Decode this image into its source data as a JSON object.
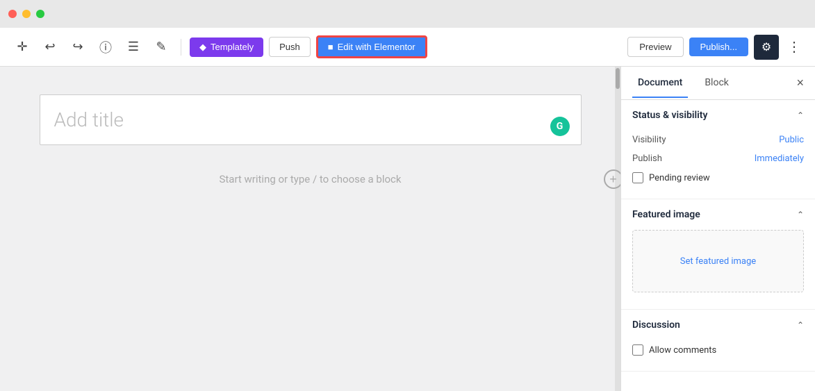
{
  "titlebar": {
    "traffic_lights": [
      "red",
      "yellow",
      "green"
    ]
  },
  "toolbar": {
    "add_label": "+",
    "undo_label": "↩",
    "redo_label": "↪",
    "info_label": "ℹ",
    "list_label": "☰",
    "edit_label": "✎",
    "templately_label": "Templately",
    "push_label": "Push",
    "elementor_label": "Edit with Elementor",
    "preview_label": "Preview",
    "publish_label": "Publish...",
    "settings_label": "⚙",
    "more_label": "⋮"
  },
  "editor": {
    "title_placeholder": "Add title",
    "content_placeholder": "Start writing or type / to choose a block",
    "grammarly_letter": "G"
  },
  "right_panel": {
    "tab_document": "Document",
    "tab_block": "Block",
    "close_label": "×",
    "status_section": {
      "title": "Status & visibility",
      "visibility_label": "Visibility",
      "visibility_value": "Public",
      "publish_label": "Publish",
      "publish_value": "Immediately",
      "pending_review_label": "Pending review"
    },
    "featured_image_section": {
      "title": "Featured image",
      "set_image_label": "Set featured image"
    },
    "discussion_section": {
      "title": "Discussion",
      "allow_comments_label": "Allow comments"
    }
  }
}
